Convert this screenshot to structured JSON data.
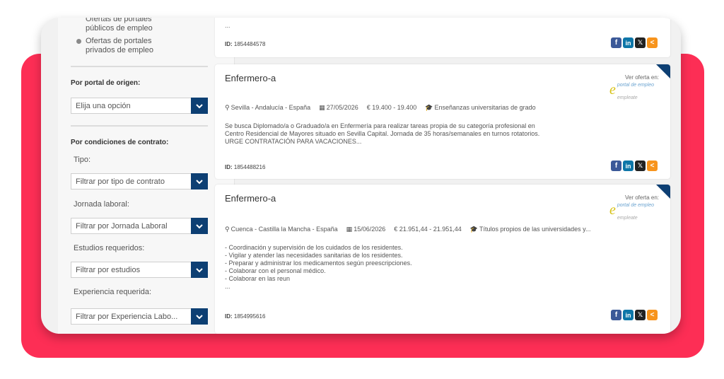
{
  "sidebar": {
    "radio_options": [
      {
        "line1": "Ofertas de portales",
        "line2": "públicos de empleo",
        "selected": false
      },
      {
        "line1": "Ofertas de portales",
        "line2": "privados de empleo",
        "selected": true
      }
    ],
    "portal_origen": {
      "heading": "Por portal de origen:",
      "select": "Elija una opción"
    },
    "condiciones": {
      "heading": "Por condiciones de contrato:",
      "tipo_label": "Tipo:",
      "tipo_select": "Filtrar por tipo de contrato",
      "jornada_label": "Jornada laboral:",
      "jornada_select": "Filtrar por Jornada Laboral",
      "estudios_label": "Estudios requeridos:",
      "estudios_select": "Filtrar por estudios",
      "experiencia_label": "Experiencia requerida:",
      "experiencia_select": "Filtrar por Experiencia Labo..."
    }
  },
  "cards": [
    {
      "ellipsis": "...",
      "id_label": "ID:",
      "id_value": "1854484578"
    },
    {
      "title": "Enfermero-a",
      "ver_oferta": "Ver oferta en:",
      "portal_name": "portal de empleo",
      "portal_sub": "empleate",
      "location": "Sevilla - Andalucía - España",
      "date": "27/05/2026",
      "salary": "€ 19.400 - 19.400",
      "education": "Enseñanzas universitarias de grado",
      "description": [
        "Se busca Diplomado/a o Graduado/a en Enfermería para realizar tareas propia de su categoría profesional en",
        "Centro Residencial de Mayores situado en Sevilla Capital. Jornada de 35 horas/semanales en turnos rotatorios.",
        "URGE CONTRATACIÓN PARA VACACIONES..."
      ],
      "id_label": "ID:",
      "id_value": "1854488216"
    },
    {
      "title": "Enfermero-a",
      "ver_oferta": "Ver oferta en:",
      "portal_name": "portal de empleo",
      "portal_sub": "empleate",
      "location": "Cuenca - Castilla la Mancha - España",
      "date": "15/06/2026",
      "salary": "€ 21.951,44 - 21.951,44",
      "education": "Títulos propios de las universidades y...",
      "description": [
        "- Coordinación y supervisión de los cuidados de los residentes.",
        "- Vigilar y atender las necesidades sanitarias de los residentes.",
        "- Preparar y administrar los medicamentos según preescripciones.",
        "- Colaborar con el personal médico.",
        "- Colaborar en las reun",
        "..."
      ],
      "id_label": "ID:",
      "id_value": "1854995616"
    }
  ],
  "share_icons": [
    "facebook-icon",
    "linkedin-icon",
    "x-icon",
    "share-icon"
  ],
  "colors": {
    "accent": "#0d3f73",
    "background": "#fd2e55",
    "share_orange": "#f7941d"
  }
}
